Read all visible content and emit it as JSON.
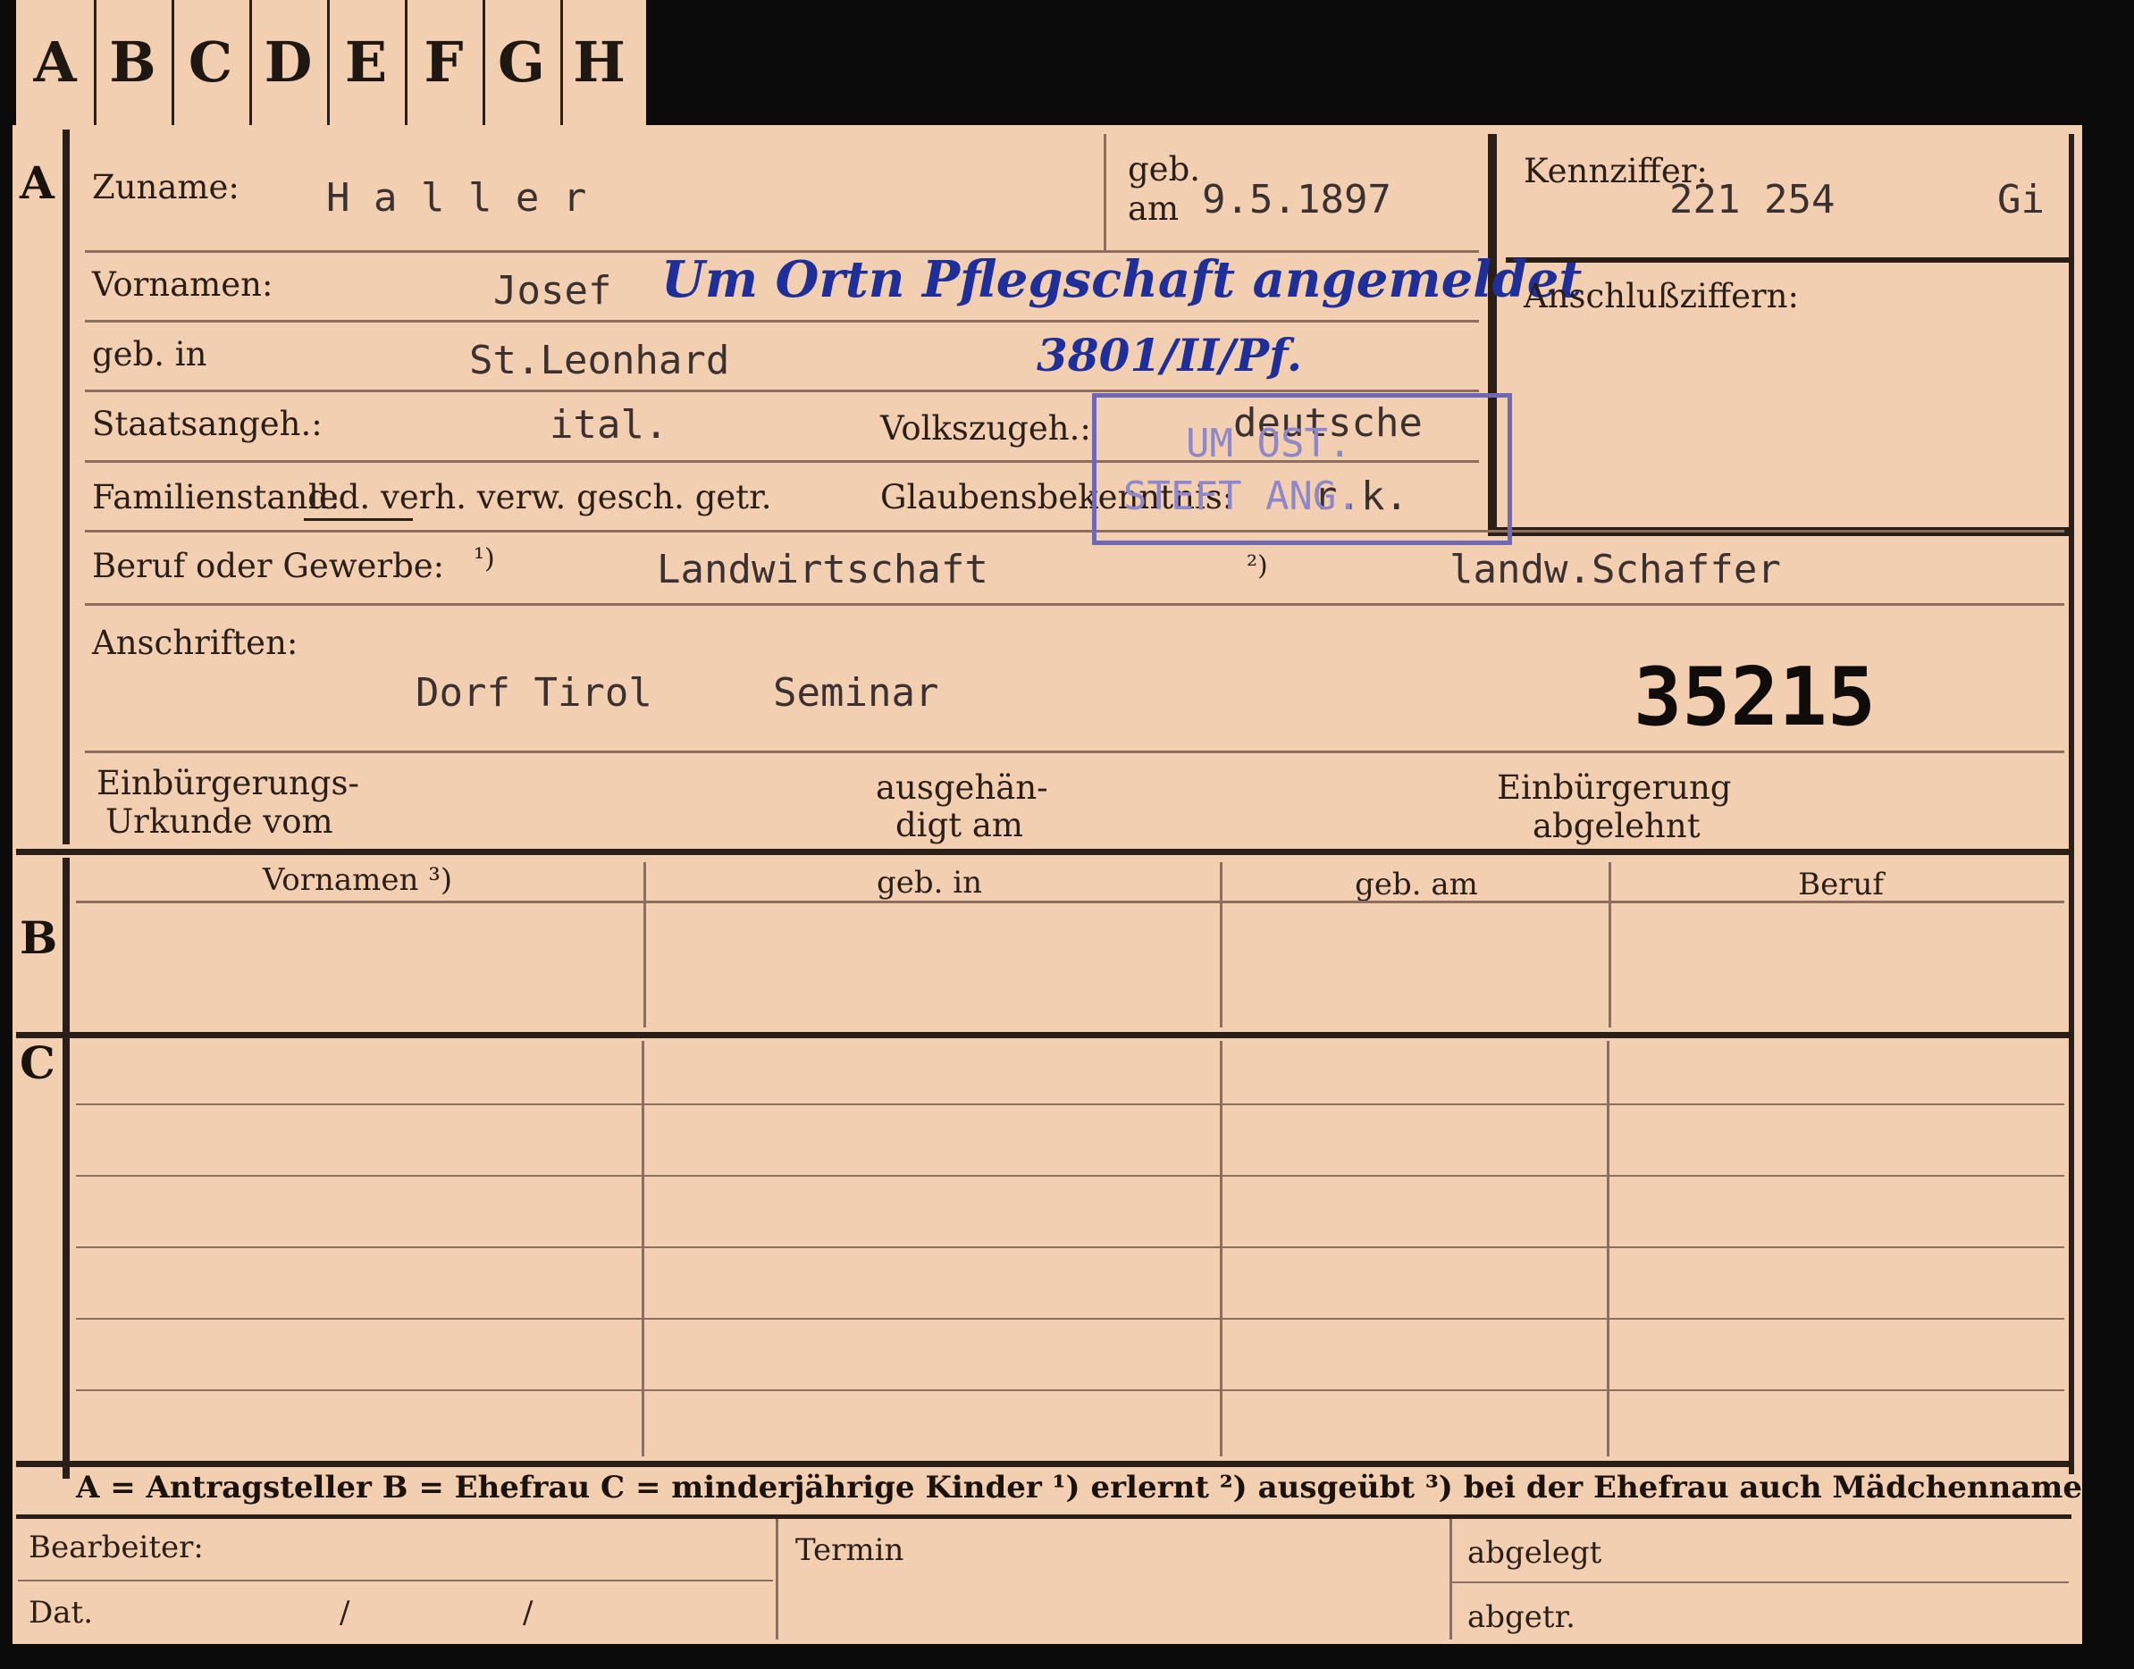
{
  "tabs": [
    "A",
    "B",
    "C",
    "D",
    "E",
    "F",
    "G",
    "H"
  ],
  "sections": {
    "a": "A",
    "b": "B",
    "c": "C"
  },
  "labels": {
    "zuname": "Zuname:",
    "geb_am_top": "geb.",
    "geb_am_bottom": "am",
    "kennziffer": "Kennziffer:",
    "vornamen": "Vornamen:",
    "anschlussziffern": "Anschlußziffern:",
    "geb_in": "geb. in",
    "staatsangeh": "Staatsangeh.:",
    "volkszugeh": "Volkszugeh.:",
    "familienstand": "Familienstand:",
    "familienstand_options": "led. verh. verw. gesch. getr.",
    "glaubensbekenntnis": "Glaubensbekenntnis:",
    "beruf": "Beruf oder Gewerbe:",
    "beruf_mark1": "¹)",
    "beruf_mark2": "²)",
    "anschriften": "Anschriften:",
    "einbuergerung_urkunde_1": "Einbürgerungs-",
    "einbuergerung_urkunde_2": "Urkunde vom",
    "ausgehaendigt_1": "ausgehän-",
    "ausgehaendigt_2": "digt am",
    "einbuergerung_abgelehnt_1": "Einbürgerung",
    "einbuergerung_abgelehnt_2": "abgelehnt"
  },
  "values": {
    "zuname": "H a l l e r",
    "geb_am": "9.5.1897",
    "kennziffer": "221 254",
    "kennziffer_suffix": "Gi",
    "vornamen": "Josef",
    "geb_in": "St.Leonhard",
    "staatsangeh": "ital.",
    "volkszugeh": "deutsche",
    "glaubensbekenntnis": "r.k.",
    "beruf_erlernt": "Landwirtschaft",
    "beruf_ausgeuebt": "landw.Schaffer",
    "anschrift_ort": "Dorf Tirol",
    "anschrift_zusatz": "Seminar",
    "stamp_number": "35215"
  },
  "handwriting": {
    "note": "Um Ortn Pflegschaft angemeldet",
    "ref": "3801/II/Pf."
  },
  "stamp": {
    "line1": "UM OST.",
    "line2": "STEFT ANG."
  },
  "table_headers": [
    "Vornamen ³)",
    "geb. in",
    "geb. am",
    "Beruf"
  ],
  "legend": "A = Antragsteller   B = Ehefrau   C = minderjährige Kinder   ¹) erlernt   ²) ausgeübt   ³) bei der Ehefrau auch Mädchenname",
  "footer": {
    "bearbeiter": "Bearbeiter:",
    "termin": "Termin",
    "abgelegt": "abgelegt",
    "dat": "Dat.",
    "dat_sep1": "/",
    "dat_sep2": "/",
    "abgetr": "abgetr."
  },
  "colors": {
    "paper": "#f3cfb2",
    "ink": "#2a1f18",
    "stamp": "#6f68b6",
    "handwriting": "#1e2f9a"
  }
}
